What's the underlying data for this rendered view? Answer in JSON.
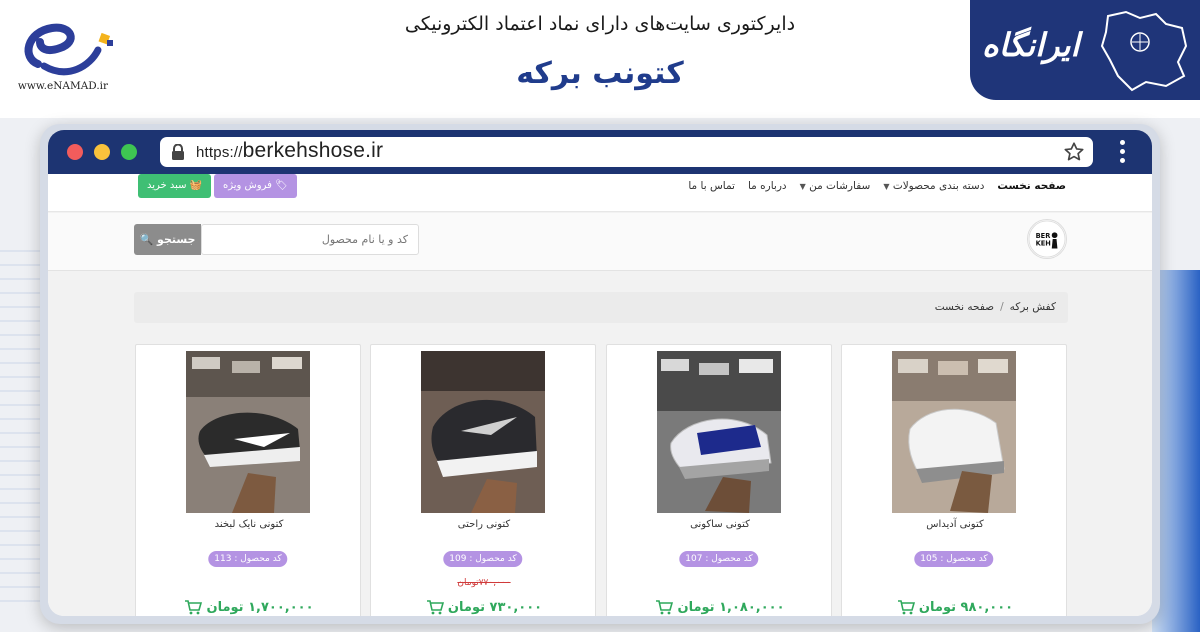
{
  "directory": {
    "title": "دایرکتوری سایت‌های دارای نماد اعتماد الکترونیکی",
    "site_name": "کتونب برکه",
    "enamad_url": "www.eNAMAD.ir",
    "brand_logo_text": "ایرانگاه"
  },
  "browser": {
    "url_protocol": "https://",
    "url_domain": "berkehshose.ir"
  },
  "nav": {
    "items": [
      {
        "label": "صفحه نخست",
        "active": true,
        "dropdown": false
      },
      {
        "label": "دسته بندی محصولات",
        "active": false,
        "dropdown": true
      },
      {
        "label": "سفارشات من",
        "active": false,
        "dropdown": true
      },
      {
        "label": "درباره ما",
        "active": false,
        "dropdown": false
      },
      {
        "label": "تماس با ما",
        "active": false,
        "dropdown": false
      }
    ],
    "special_sale_label": "فروش ویژه",
    "cart_label": "سبد خرید"
  },
  "search": {
    "placeholder": "کد و یا نام محصول",
    "button_label": "جستجو"
  },
  "logo_text": "BERKEH",
  "breadcrumb": {
    "items": [
      "کفش برکه",
      "صفحه نخست"
    ]
  },
  "products": [
    {
      "name": "کتونی آدیداس",
      "code": "کد محصول : 105",
      "old_price": "",
      "price": "۹۸۰,۰۰۰ تومان"
    },
    {
      "name": "کتونی ساکونی",
      "code": "کد محصول : 107",
      "old_price": "",
      "price": "۱,۰۸۰,۰۰۰ تومان"
    },
    {
      "name": "کتونی راحتی",
      "code": "کد محصول : 109",
      "old_price": "۷۷۰,۰۰۰تومان",
      "price": "۷۳۰,۰۰۰ تومان"
    },
    {
      "name": "کتونی نایک لبخند",
      "code": "کد محصول : 113",
      "old_price": "",
      "price": "۱,۷۰۰,۰۰۰ تومان"
    }
  ],
  "colors": {
    "brand_navy": "#1d3472",
    "special_purple": "#b493e3",
    "cart_green": "#3fbf74",
    "price_green": "#2fa85c"
  }
}
